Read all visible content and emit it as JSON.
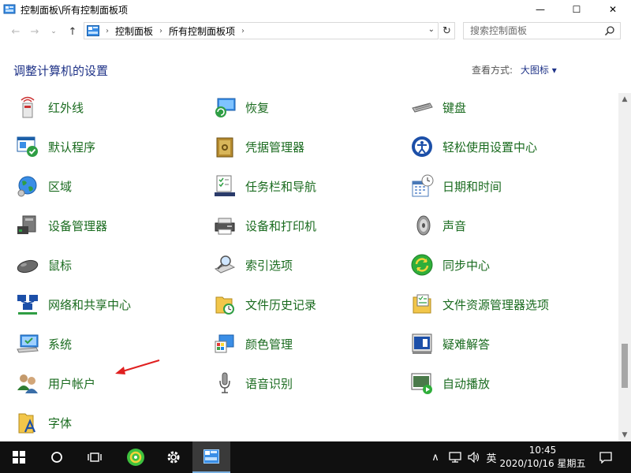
{
  "window": {
    "title": "控制面板\\所有控制面板项",
    "minimize_glyph": "—",
    "maximize_glyph": "☐",
    "close_glyph": "✕"
  },
  "address": {
    "crumbs": [
      "控制面板",
      "所有控制面板项"
    ],
    "search_placeholder": "搜索控制面板"
  },
  "header": {
    "title": "调整计算机的设置",
    "view_by_label": "查看方式:",
    "view_by_value": "大图标 ▾"
  },
  "items": {
    "infrared": "红外线",
    "recovery": "恢复",
    "keyboard": "键盘",
    "default_programs": "默认程序",
    "credential_manager": "凭据管理器",
    "ease_of_access": "轻松使用设置中心",
    "region": "区域",
    "taskbar_navigation": "任务栏和导航",
    "date_time": "日期和时间",
    "device_manager": "设备管理器",
    "devices_printers": "设备和打印机",
    "sound": "声音",
    "mouse": "鼠标",
    "indexing_options": "索引选项",
    "sync_center": "同步中心",
    "network_sharing": "网络和共享中心",
    "file_history": "文件历史记录",
    "file_explorer_options": "文件资源管理器选项",
    "system": "系统",
    "color_management": "颜色管理",
    "troubleshooting": "疑难解答",
    "user_accounts": "用户帐户",
    "speech_recognition": "语音识别",
    "autoplay": "自动播放",
    "fonts": "字体"
  },
  "taskbar": {
    "ime": "英",
    "time": "10:45",
    "date": "2020/10/16 星期五"
  },
  "colors": {
    "link_green": "#1a6b1f",
    "heading_blue": "#1e3287",
    "annotation_red": "#e02020",
    "taskbar_bg": "#101010"
  }
}
